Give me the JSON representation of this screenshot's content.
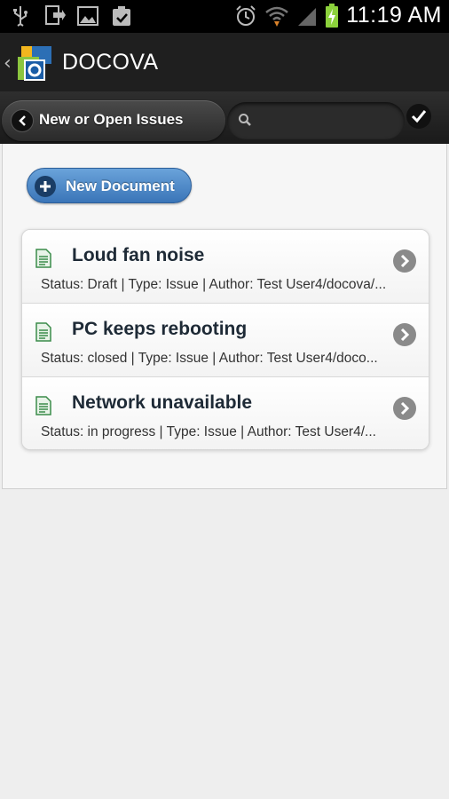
{
  "status_bar": {
    "icons": [
      "usb-icon",
      "download-icon",
      "image-icon",
      "clipboard-check-icon",
      "alarm-icon",
      "wifi-icon",
      "signal-icon",
      "battery-charging-icon"
    ],
    "time": "11:19 AM"
  },
  "app_bar": {
    "title": "DOCOVA",
    "back_icon": "chevron-left-icon",
    "logo_icon": "docova-logo-icon"
  },
  "toolbar": {
    "view_title": "New or Open Issues",
    "search_placeholder": "",
    "search_value": ""
  },
  "actions": {
    "new_document_label": "New Document"
  },
  "documents": [
    {
      "title": "Loud fan noise",
      "meta": "Status: Draft  |  Type: Issue  |  Author: Test User4/docova/..."
    },
    {
      "title": "PC keeps rebooting",
      "meta": "Status: closed  |  Type: Issue  |  Author: Test User4/doco..."
    },
    {
      "title": "Network unavailable",
      "meta": "Status: in progress  |  Type: Issue  |  Author: Test User4/..."
    }
  ],
  "colors": {
    "accent": "#3a75b8",
    "bar": "#1f1f1f",
    "background": "#eeeeee"
  }
}
